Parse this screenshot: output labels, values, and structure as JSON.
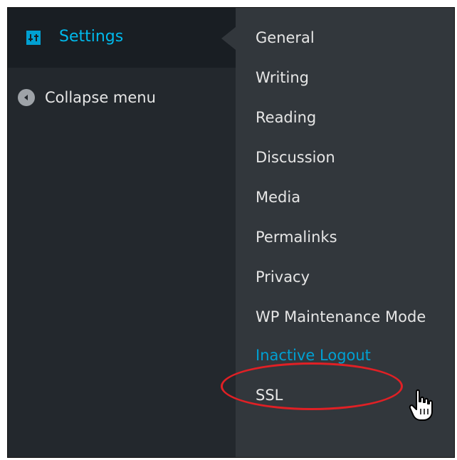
{
  "sidebar": {
    "settings_label": "Settings",
    "collapse_label": "Collapse menu",
    "settings_icon": "settings-sliders-icon",
    "collapse_icon": "collapse-arrow-icon"
  },
  "submenu": {
    "items": [
      {
        "label": "General"
      },
      {
        "label": "Writing"
      },
      {
        "label": "Reading"
      },
      {
        "label": "Discussion"
      },
      {
        "label": "Media"
      },
      {
        "label": "Permalinks"
      },
      {
        "label": "Privacy"
      },
      {
        "label": "WP Maintenance Mode"
      },
      {
        "label": "Inactive Logout"
      },
      {
        "label": "SSL"
      }
    ]
  },
  "colors": {
    "sidebar_bg": "#23282d",
    "submenu_bg": "#32373c",
    "accent": "#00a0d2",
    "highlight_ring": "#e02025"
  }
}
